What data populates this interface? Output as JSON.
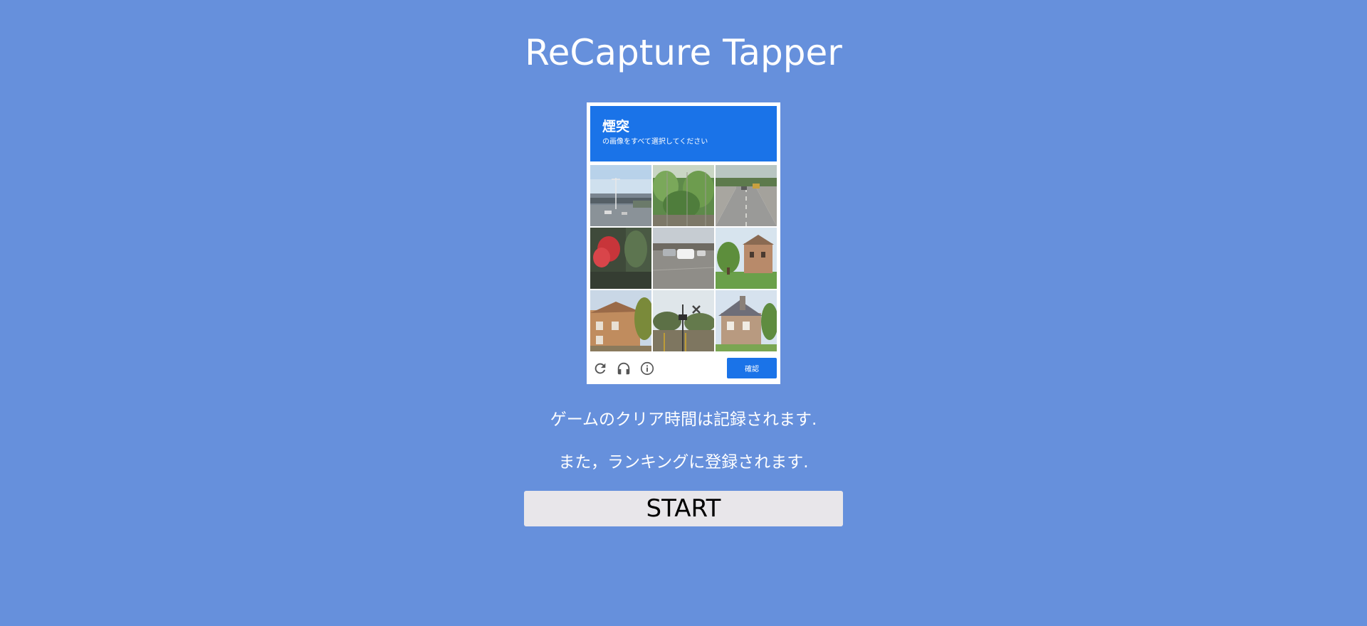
{
  "page": {
    "title": "ReCapture Tapper",
    "background_color": "#6690dc"
  },
  "captcha": {
    "target": "煙突",
    "instruction": "の画像をすべて選択してください",
    "header_color": "#1a73e8",
    "tiles": [
      {
        "scene": "overpass-with-lamp"
      },
      {
        "scene": "green-bushes-fence"
      },
      {
        "scene": "road-with-car"
      },
      {
        "scene": "blurry-red-motorbike"
      },
      {
        "scene": "street-white-car"
      },
      {
        "scene": "house-with-trees"
      },
      {
        "scene": "house-with-tree"
      },
      {
        "scene": "crossing-sign"
      },
      {
        "scene": "house-with-chimney"
      }
    ],
    "footer": {
      "reload_icon": "reload-icon",
      "audio_icon": "headphones-icon",
      "info_icon": "info-icon",
      "verify_label": "確認"
    }
  },
  "messages": {
    "line1": "ゲームのクリア時間は記録されます.",
    "line2": "また，ランキングに登録されます."
  },
  "start_button": {
    "label": "START"
  }
}
